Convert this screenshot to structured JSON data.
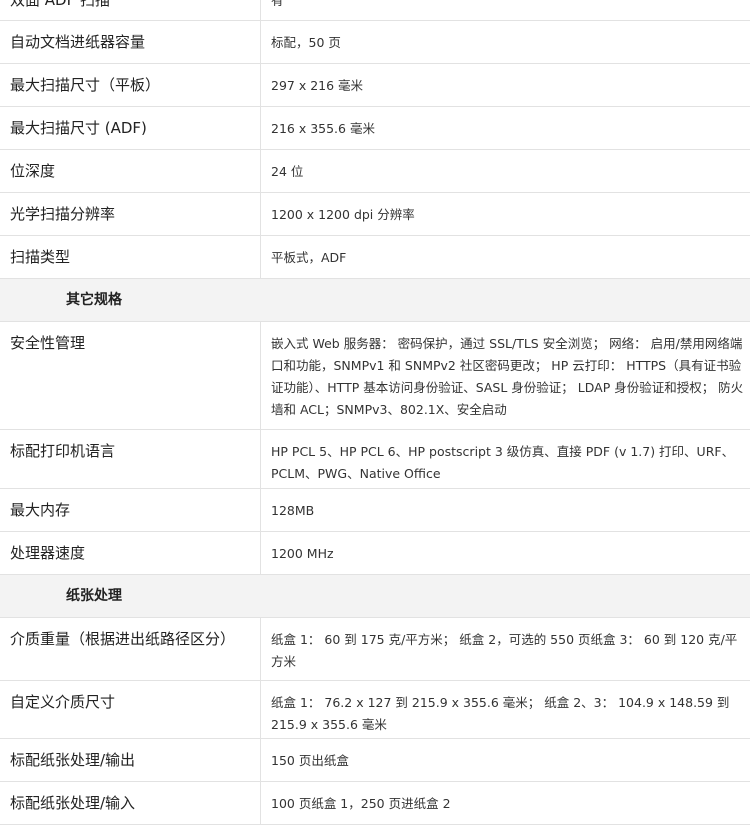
{
  "rows": [
    {
      "type": "row",
      "label": "双面 ADF 扫描",
      "value": "有",
      "h": 42
    },
    {
      "type": "row",
      "label": "自动文档进纸器容量",
      "value": "标配，50 页",
      "h": 43
    },
    {
      "type": "row",
      "label": "最大扫描尺寸（平板）",
      "value": "297 x 216 毫米",
      "h": 43
    },
    {
      "type": "row",
      "label": "最大扫描尺寸 (ADF)",
      "value": "216 x 355.6 毫米",
      "h": 43
    },
    {
      "type": "row",
      "label": "位深度",
      "value": "24 位",
      "h": 43
    },
    {
      "type": "row",
      "label": "光学扫描分辨率",
      "value": "1200 x 1200 dpi 分辨率",
      "h": 43
    },
    {
      "type": "row",
      "label": "扫描类型",
      "value": "平板式，ADF",
      "h": 43
    },
    {
      "type": "section",
      "label": "其它规格",
      "h": 43
    },
    {
      "type": "row",
      "label": "安全性管理",
      "value": "嵌入式 Web 服务器： 密码保护，通过 SSL/TLS 安全浏览； 网络： 启用/禁用网络端口和功能，SNMPv1 和 SNMPv2 社区密码更改； HP 云打印： HTTPS（具有证书验证功能）、HTTP 基本访问身份验证、SASL 身份验证； LDAP 身份验证和授权； 防火墙和 ACL；SNMPv3、802.1X、安全启动",
      "h": 108
    },
    {
      "type": "row",
      "label": "标配打印机语言",
      "value": "HP PCL 5、HP PCL 6、HP postscript 3 级仿真、直接 PDF (v 1.7) 打印、URF、PCLM、PWG、Native Office",
      "h": 59
    },
    {
      "type": "row",
      "label": "最大内存",
      "value": "128MB",
      "h": 43
    },
    {
      "type": "row",
      "label": "处理器速度",
      "value": "1200 MHz",
      "h": 43
    },
    {
      "type": "section",
      "label": "纸张处理",
      "h": 43
    },
    {
      "type": "row",
      "label": "介质重量（根据进出纸路径区分）",
      "value": "纸盒 1： 60 到 175 克/平方米； 纸盒 2，可选的 550 页纸盒 3： 60 到 120 克/平方米",
      "h": 63
    },
    {
      "type": "row",
      "label": "自定义介质尺寸",
      "value": "纸盒 1： 76.2 x 127 到 215.9 x 355.6 毫米； 纸盒 2、3： 104.9 x 148.59 到 215.9 x 355.6 毫米",
      "h": 58
    },
    {
      "type": "row",
      "label": "标配纸张处理/输出",
      "value": "150 页出纸盒",
      "h": 43
    },
    {
      "type": "row",
      "label": "标配纸张处理/输入",
      "value": "100 页纸盒 1，250 页进纸盒 2",
      "h": 43
    }
  ]
}
